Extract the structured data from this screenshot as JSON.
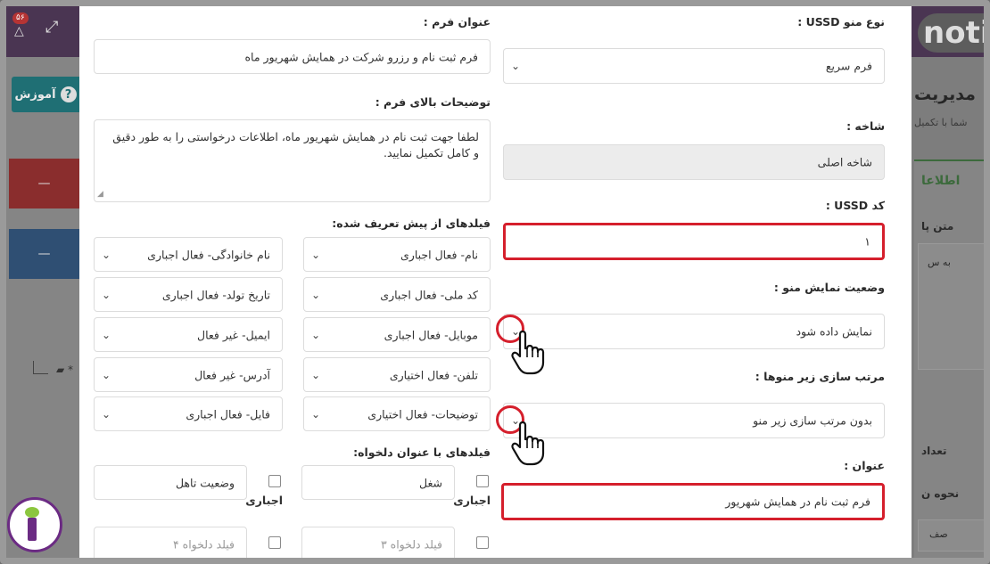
{
  "background": {
    "notification_count": "۵۶",
    "learn_button": "آموزش",
    "learn_icon": "?",
    "panel_dash_1": "—",
    "panel_dash_2": "—",
    "tree_star": "*",
    "logo_text": "noti",
    "page_title": "مدیریت",
    "page_subtitle": "شما با تکمیل",
    "card_heading": "اطلاعا",
    "card_text_label": "متن پا",
    "card_text_value": "به س",
    "count_label": "تعداد",
    "mode_label": "نحوه ن",
    "mode_value": "صف"
  },
  "form": {
    "ussd_type": {
      "label": "نوع منو USSD :",
      "value": "فرم سریع"
    },
    "branch": {
      "label": "شاخه :",
      "value": "شاخه اصلی"
    },
    "ussd_code": {
      "label": "کد USSD :",
      "value": "۱"
    },
    "display_status": {
      "label": "وضعیت نمایش منو :",
      "value": "نمایش داده شود"
    },
    "submenu_sort": {
      "label": "مرتب سازی زیر منوها :",
      "value": "بدون مرتب سازی زیر منو"
    },
    "title": {
      "label": "عنوان :",
      "value": "فرم ثبت نام در همایش شهریور"
    },
    "form_title": {
      "label": "عنوان فرم :",
      "value": "فرم ثبت نام و رزرو شرکت در همایش شهریور ماه"
    },
    "form_description": {
      "label": "توضیحات بالای فرم :",
      "value": "لطفا جهت ثبت نام در همایش شهریور ماه، اطلاعات درخواستی را به طور دقیق و کامل تکمیل نمایید."
    },
    "predefined_label": "فیلدهای از پیش تعریف شده:",
    "predefined_fields": [
      "نام- فعال اجباری",
      "نام خانوادگی- فعال اجباری",
      "کد ملی- فعال اجباری",
      "تاریخ تولد- فعال اجباری",
      "موبایل- فعال اجباری",
      "ایمیل- غیر فعال",
      "تلفن- فعال اختیاری",
      "آدرس- غیر فعال",
      "توضیحات- فعال اختیاری",
      "فایل- فعال اجباری"
    ],
    "custom_label": "فیلدهای با عنوان دلخواه:",
    "custom_fields": [
      {
        "value": "شغل",
        "required_label": "اجباری"
      },
      {
        "value": "وضعیت تاهل",
        "required_label": "اجباری"
      },
      {
        "placeholder": "فیلد دلخواه ۳"
      },
      {
        "placeholder": "فیلد دلخواه ۴"
      }
    ]
  }
}
